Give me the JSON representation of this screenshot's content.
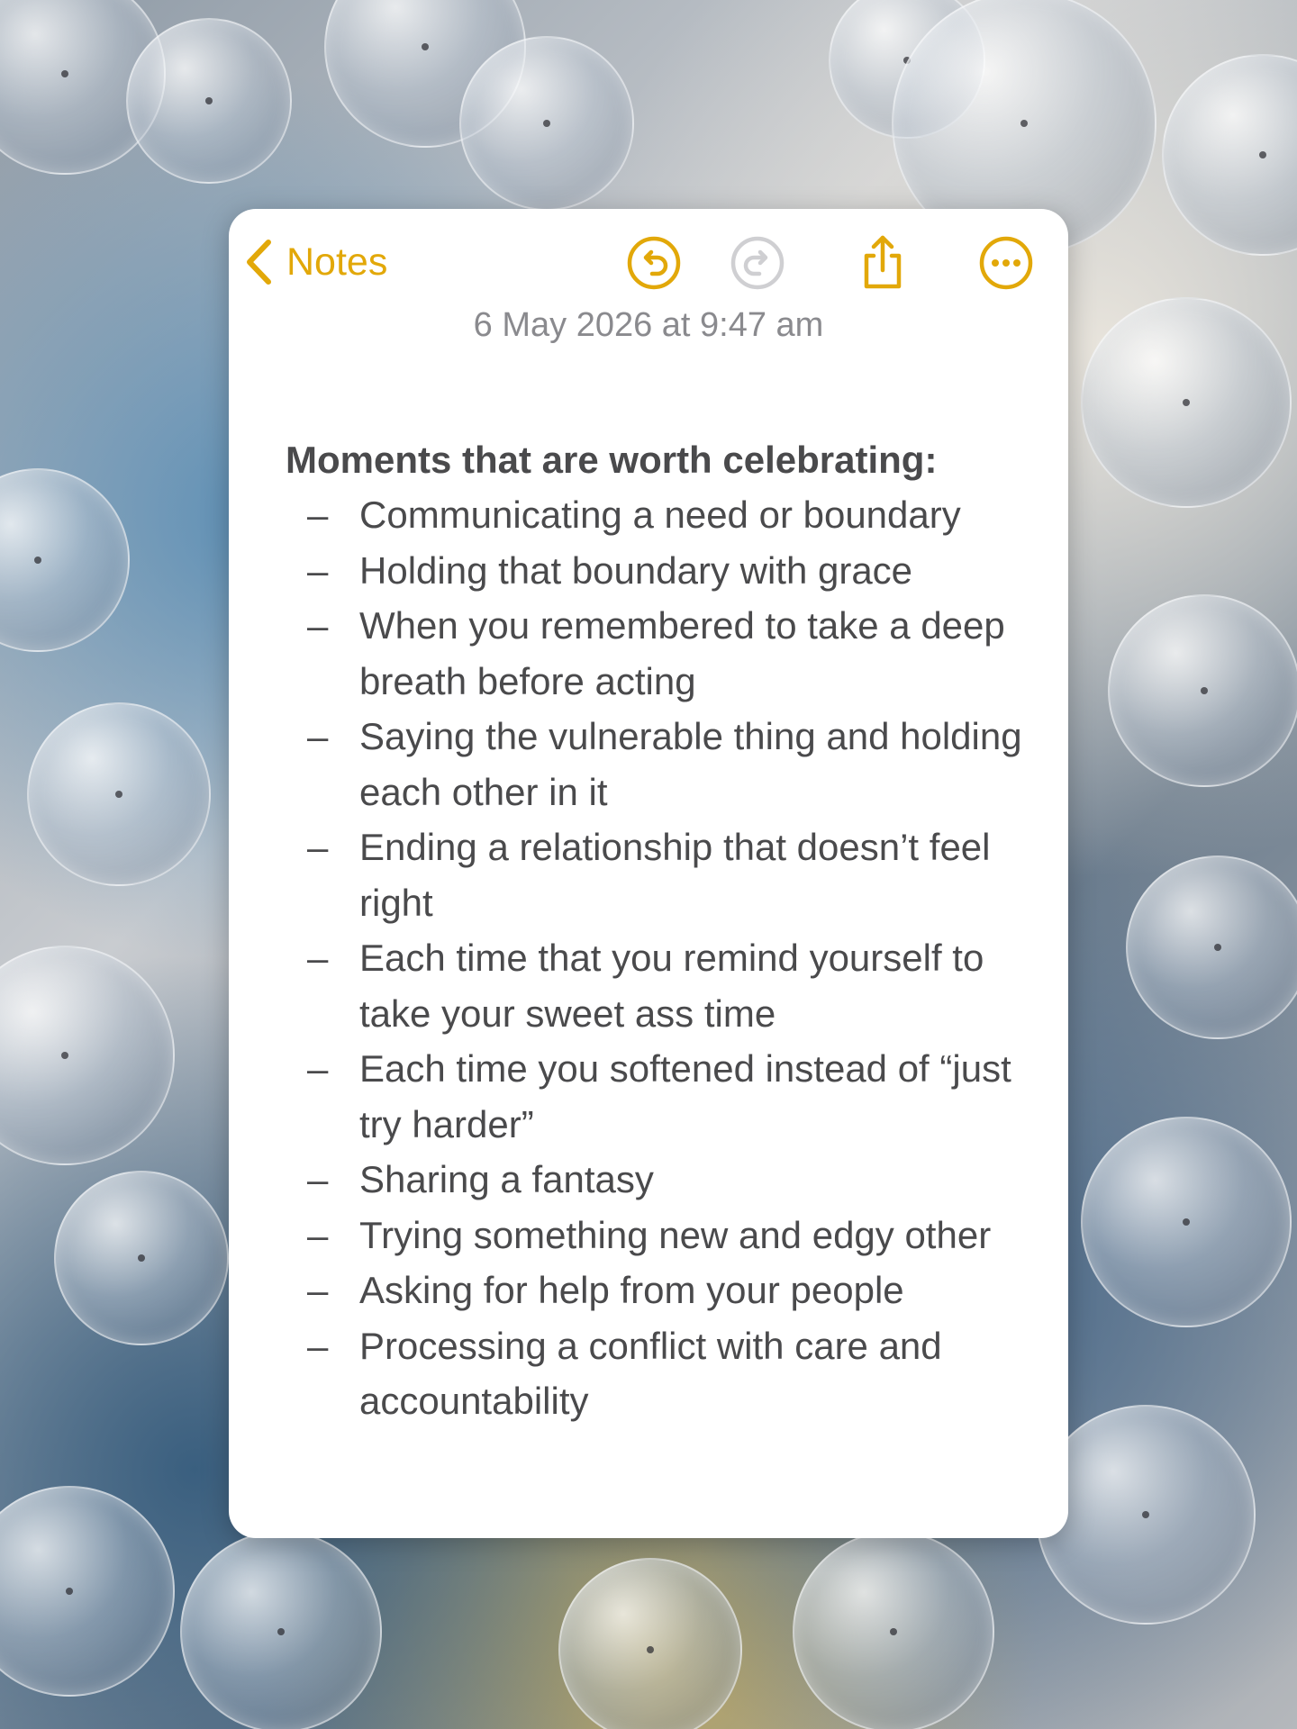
{
  "toolbar": {
    "back_label": "Notes",
    "accent_color": "#E2A809",
    "icons": [
      "chevron-left-icon",
      "undo-icon",
      "redo-icon",
      "share-icon",
      "more-icon"
    ]
  },
  "note": {
    "date": "6 May 2026 at 9:47 am",
    "heading": "Moments that are worth celebrating:",
    "items": [
      "Communicating a need or boundary",
      "Holding that boundary with grace",
      "When you remembered to take a deep breath before acting",
      "Saying the vulnerable thing and holding each other in it",
      "Ending a relationship that doesn’t feel right",
      "Each time that you remind yourself to take your sweet ass time",
      "Each time you softened instead of “just try harder”",
      "Sharing a fantasy",
      "Trying something new and edgy other",
      "Asking for help from your people",
      "Processing a conflict with care and accountability"
    ],
    "bullet": "–"
  }
}
